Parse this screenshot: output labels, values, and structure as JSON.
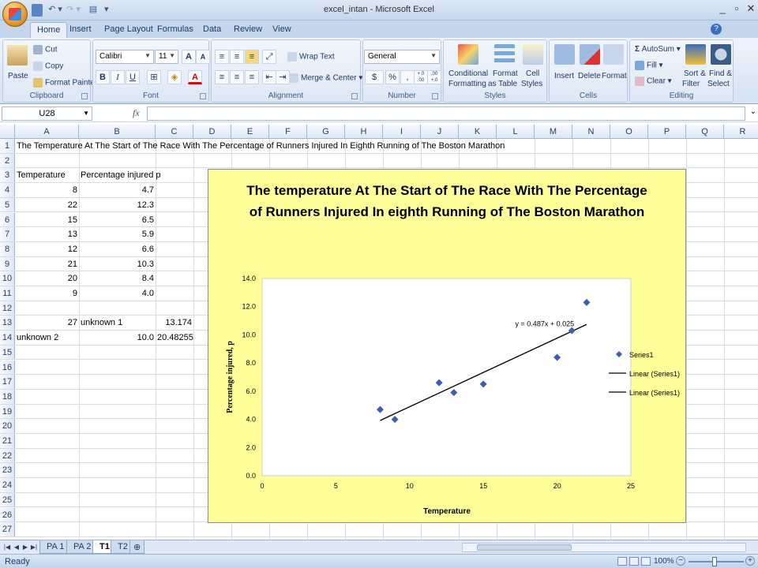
{
  "window": {
    "title": "excel_intan - Microsoft Excel",
    "minimize": "_",
    "restore": "▫",
    "close": "✕"
  },
  "qat": {
    "undo": "↶ ▾",
    "redo": "↷ ▾",
    "customize": "▾"
  },
  "tabs": [
    "Home",
    "Insert",
    "Page Layout",
    "Formulas",
    "Data",
    "Review",
    "View"
  ],
  "ribbon": {
    "clipboard": {
      "label": "Clipboard",
      "paste": "Paste",
      "cut": "Cut",
      "copy": "Copy",
      "format_painter": "Format Painter"
    },
    "font": {
      "label": "Font",
      "name": "Calibri",
      "size": "11",
      "grow": "A",
      "shrink": "A",
      "bold": "B",
      "italic": "I",
      "underline": "U"
    },
    "alignment": {
      "label": "Alignment",
      "wrap_text": "Wrap Text",
      "merge_center": "Merge & Center"
    },
    "number": {
      "label": "Number",
      "format": "General",
      "currency": "$",
      "percent": "%",
      "comma": ",",
      "inc_decimal": "+.0 .00",
      "dec_decimal": ".00 +.0"
    },
    "styles": {
      "label": "Styles",
      "conditional": "Conditional",
      "conditional2": "Formatting",
      "format_table": "Format",
      "format_table2": "as Table",
      "cell_styles": "Cell",
      "cell_styles2": "Styles"
    },
    "cells": {
      "label": "Cells",
      "insert": "Insert",
      "delete": "Delete",
      "format": "Format"
    },
    "editing": {
      "label": "Editing",
      "autosum": "AutoSum",
      "fill": "Fill",
      "clear": "Clear",
      "sort": "Sort &",
      "sort2": "Filter",
      "find": "Find &",
      "find2": "Select"
    }
  },
  "formula_bar": {
    "name_box": "U28",
    "fx": "fx",
    "value": ""
  },
  "columns": [
    "A",
    "B",
    "C",
    "D",
    "E",
    "F",
    "G",
    "H",
    "I",
    "J",
    "K",
    "L",
    "M",
    "N",
    "O",
    "P",
    "Q",
    "R"
  ],
  "rows": [
    "1",
    "2",
    "3",
    "4",
    "5",
    "6",
    "7",
    "8",
    "9",
    "10",
    "11",
    "12",
    "13",
    "14",
    "15",
    "16",
    "17",
    "18",
    "19",
    "20",
    "21",
    "22",
    "23",
    "24",
    "25",
    "26",
    "27"
  ],
  "cells": {
    "a1": "The Temperature At The Start of The Race With The Percentage of Runners Injured In Eighth Running of The Boston Marathon",
    "a3": "Temperature",
    "b3": "Percentage injured p",
    "data": [
      {
        "t": "8",
        "p": "4.7"
      },
      {
        "t": "22",
        "p": "12.3"
      },
      {
        "t": "15",
        "p": "6.5"
      },
      {
        "t": "13",
        "p": "5.9"
      },
      {
        "t": "12",
        "p": "6.6"
      },
      {
        "t": "21",
        "p": "10.3"
      },
      {
        "t": "20",
        "p": "8.4"
      },
      {
        "t": "9",
        "p": "4.0"
      }
    ],
    "a13": "27",
    "b13": "unknown 1",
    "c13": "13.174",
    "a14": "unknown 2",
    "b14": "10.0",
    "c14": "20.48255"
  },
  "chart_data": {
    "type": "scatter",
    "title": "The temperature At The Start of The Race With The Percentage of Runners Injured In eighth Running of The Boston Marathon",
    "title_lines": [
      "The temperature At The Start of The Race With The Percentage",
      "of Runners Injured In eighth Running of The Boston Marathon"
    ],
    "xlabel": "Temperature",
    "ylabel": "Percentage injured, p",
    "xlim": [
      0,
      25
    ],
    "ylim": [
      0,
      14
    ],
    "xticks": [
      0,
      5,
      10,
      15,
      20,
      25
    ],
    "yticks": [
      "0.0",
      "2.0",
      "4.0",
      "6.0",
      "8.0",
      "10.0",
      "12.0",
      "14.0"
    ],
    "series": [
      {
        "name": "Series1",
        "x": [
          8,
          22,
          15,
          13,
          12,
          21,
          20,
          9
        ],
        "y": [
          4.7,
          12.3,
          6.5,
          5.9,
          6.6,
          10.3,
          8.4,
          4.0
        ],
        "color": "#3b5faa"
      }
    ],
    "trendline": {
      "slope": 0.487,
      "intercept": 0.025,
      "x_range": [
        8,
        22
      ],
      "equation": "y = 0.487x + 0.025"
    },
    "legend": [
      "Series1",
      "Linear (Series1)",
      "Linear (Series1)"
    ],
    "legend_position": "right",
    "background": "#ffff99"
  },
  "sheets": [
    "PA 1",
    "PA 2",
    "T1",
    "T2"
  ],
  "active_sheet": "T1",
  "status": {
    "text": "Ready",
    "zoom": "100%"
  }
}
